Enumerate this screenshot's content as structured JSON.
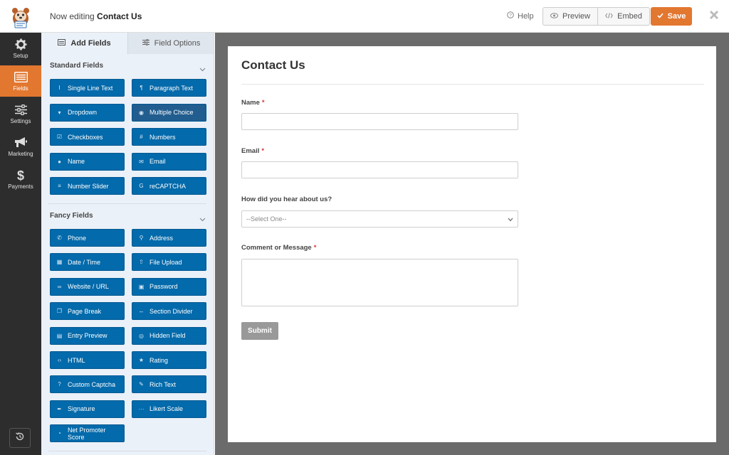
{
  "header": {
    "editing_prefix": "Now editing",
    "form_name": "Contact Us",
    "help_label": "Help",
    "preview_label": "Preview",
    "embed_label": "Embed",
    "save_label": "Save",
    "accent_color": "#e27730"
  },
  "sidebar": {
    "items": [
      {
        "label": "Setup",
        "icon": "gear-icon"
      },
      {
        "label": "Fields",
        "icon": "fields-list-icon",
        "active": true
      },
      {
        "label": "Settings",
        "icon": "sliders-icon"
      },
      {
        "label": "Marketing",
        "icon": "megaphone-icon"
      },
      {
        "label": "Payments",
        "icon": "dollar-icon"
      }
    ],
    "history_icon": "history-icon"
  },
  "panel": {
    "tabs": [
      {
        "label": "Add Fields",
        "icon": "list-icon",
        "active": true
      },
      {
        "label": "Field Options",
        "icon": "sliders-icon",
        "active": false
      }
    ],
    "standard_title": "Standard Fields",
    "fancy_title": "Fancy Fields",
    "standard_fields": [
      {
        "label": "Single Line Text",
        "icon": "text-cursor-icon"
      },
      {
        "label": "Paragraph Text",
        "icon": "paragraph-icon"
      },
      {
        "label": "Dropdown",
        "icon": "dropdown-icon"
      },
      {
        "label": "Multiple Choice",
        "icon": "radio-icon"
      },
      {
        "label": "Checkboxes",
        "icon": "checkbox-icon"
      },
      {
        "label": "Numbers",
        "icon": "hash-icon"
      },
      {
        "label": "Name",
        "icon": "user-icon"
      },
      {
        "label": "Email",
        "icon": "envelope-icon"
      },
      {
        "label": "Number Slider",
        "icon": "slider-icon"
      },
      {
        "label": "reCAPTCHA",
        "icon": "google-icon"
      }
    ],
    "fancy_fields": [
      {
        "label": "Phone",
        "icon": "phone-icon"
      },
      {
        "label": "Address",
        "icon": "map-pin-icon"
      },
      {
        "label": "Date / Time",
        "icon": "calendar-icon"
      },
      {
        "label": "File Upload",
        "icon": "upload-icon"
      },
      {
        "label": "Website / URL",
        "icon": "link-icon"
      },
      {
        "label": "Password",
        "icon": "lock-icon"
      },
      {
        "label": "Page Break",
        "icon": "copy-icon"
      },
      {
        "label": "Section Divider",
        "icon": "arrows-h-icon"
      },
      {
        "label": "Entry Preview",
        "icon": "file-icon"
      },
      {
        "label": "Hidden Field",
        "icon": "eye-slash-icon"
      },
      {
        "label": "HTML",
        "icon": "code-icon"
      },
      {
        "label": "Rating",
        "icon": "star-icon"
      },
      {
        "label": "Custom Captcha",
        "icon": "question-circle-icon"
      },
      {
        "label": "Rich Text",
        "icon": "edit-icon"
      },
      {
        "label": "Signature",
        "icon": "pen-icon"
      },
      {
        "label": "Likert Scale",
        "icon": "ellipsis-icon"
      },
      {
        "label": "Net Promoter Score",
        "icon": "gauge-icon"
      }
    ]
  },
  "form": {
    "title": "Contact Us",
    "fields": [
      {
        "label": "Name",
        "required": "*"
      },
      {
        "label": "Email",
        "required": "*"
      },
      {
        "label": "How did you hear about us?",
        "required": ""
      },
      {
        "label": "Comment or Message",
        "required": "*"
      }
    ],
    "select_placeholder": "--Select One--",
    "submit_label": "Submit"
  }
}
